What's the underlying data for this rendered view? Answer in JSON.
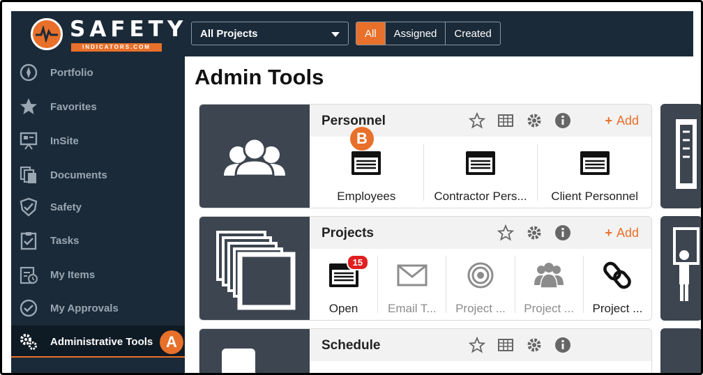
{
  "logo": {
    "word": "SAFETY",
    "sub": "INDICATORS.COM"
  },
  "topbar": {
    "project_select": "All Projects",
    "filters": [
      "All",
      "Assigned",
      "Created"
    ]
  },
  "sidebar": {
    "items": [
      {
        "label": "Portfolio",
        "icon": "compass-icon"
      },
      {
        "label": "Favorites",
        "icon": "star-icon"
      },
      {
        "label": "InSite",
        "icon": "presentation-icon"
      },
      {
        "label": "Documents",
        "icon": "documents-icon"
      },
      {
        "label": "Safety",
        "icon": "shield-check-icon"
      },
      {
        "label": "Tasks",
        "icon": "clipboard-check-icon"
      },
      {
        "label": "My Items",
        "icon": "clipboard-clock-icon"
      },
      {
        "label": "My Approvals",
        "icon": "check-circle-icon"
      },
      {
        "label": "Administrative Tools",
        "icon": "gears-icon"
      }
    ]
  },
  "callouts": {
    "a": "A",
    "b": "B"
  },
  "main": {
    "title": "Admin Tools",
    "cards": [
      {
        "title": "Personnel",
        "add_label": "Add",
        "items": [
          {
            "label": "Employees"
          },
          {
            "label": "Contractor Pers..."
          },
          {
            "label": "Client Personnel"
          }
        ]
      },
      {
        "title": "Projects",
        "add_label": "Add",
        "items": [
          {
            "label": "Open",
            "badge": "15"
          },
          {
            "label": "Email T..."
          },
          {
            "label": "Project ..."
          },
          {
            "label": "Project ..."
          },
          {
            "label": "Project ..."
          }
        ]
      },
      {
        "title": "Schedule"
      }
    ]
  },
  "colors": {
    "accent": "#e8702a",
    "navy": "#1b2a38",
    "tile": "#3c4550",
    "badge": "#e02020"
  }
}
